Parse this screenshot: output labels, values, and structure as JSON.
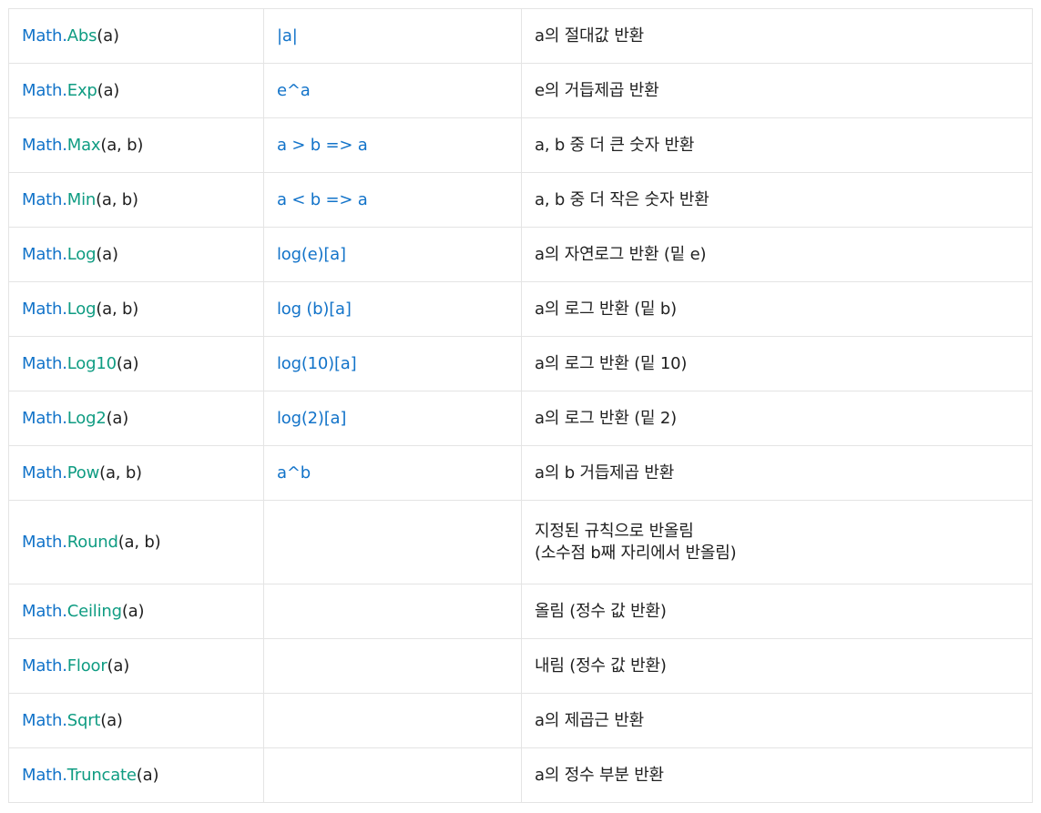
{
  "rows": [
    {
      "cls": "Math",
      "dot": ".",
      "method": "Abs",
      "args": "(a)",
      "formula": "|a|",
      "desc": [
        "a의 절대값 반환"
      ]
    },
    {
      "cls": "Math",
      "dot": ".",
      "method": "Exp",
      "args": "(a)",
      "formula": "e^a",
      "desc": [
        "e의 거듭제곱 반환"
      ]
    },
    {
      "cls": "Math",
      "dot": ".",
      "method": "Max",
      "args": "(a, b)",
      "formula": "a > b => a",
      "desc": [
        "a, b 중 더 큰 숫자 반환"
      ]
    },
    {
      "cls": "Math",
      "dot": ".",
      "method": "Min",
      "args": "(a, b)",
      "formula": "a < b => a",
      "desc": [
        "a, b 중 더 작은 숫자 반환"
      ]
    },
    {
      "cls": "Math",
      "dot": ".",
      "method": "Log",
      "args": "(a)",
      "formula": "log(e)[a]",
      "desc": [
        "a의 자연로그 반환 (밑 e)"
      ]
    },
    {
      "cls": "Math",
      "dot": ".",
      "method": "Log",
      "args": "(a, b)",
      "formula": "log (b)[a]",
      "desc": [
        "a의 로그 반환 (밑 b)"
      ]
    },
    {
      "cls": "Math",
      "dot": ".",
      "method": "Log10",
      "args": "(a)",
      "formula": "log(10)[a]",
      "desc": [
        "a의 로그 반환 (밑 10)"
      ]
    },
    {
      "cls": "Math",
      "dot": ".",
      "method": "Log2",
      "args": "(a)",
      "formula": "log(2)[a]",
      "desc": [
        "a의 로그 반환 (밑 2)"
      ]
    },
    {
      "cls": "Math",
      "dot": ".",
      "method": "Pow",
      "args": "(a, b)",
      "formula": "a^b",
      "desc": [
        "a의 b 거듭제곱 반환"
      ]
    },
    {
      "cls": "Math",
      "dot": ".",
      "method": "Round",
      "args": "(a, b)",
      "formula": "",
      "desc": [
        "지정된 규칙으로 반올림",
        "(소수점 b째 자리에서 반올림)"
      ]
    },
    {
      "cls": "Math",
      "dot": ".",
      "method": "Ceiling",
      "args": "(a)",
      "formula": "",
      "desc": [
        "올림 (정수 값 반환)"
      ]
    },
    {
      "cls": "Math",
      "dot": ".",
      "method": "Floor",
      "args": "(a)",
      "formula": "",
      "desc": [
        "내림 (정수 값 반환)"
      ]
    },
    {
      "cls": "Math",
      "dot": ".",
      "method": "Sqrt",
      "args": "(a)",
      "formula": "",
      "desc": [
        "a의 제곱근 반환"
      ]
    },
    {
      "cls": "Math",
      "dot": ".",
      "method": "Truncate",
      "args": "(a)",
      "formula": "",
      "desc": [
        "a의 정수 부분 반환"
      ]
    }
  ],
  "colors": {
    "class": "#1273c9",
    "method": "#0f9c82",
    "args": "#1f1f1f",
    "formula": "#1273c9",
    "text": "#1f1f1f",
    "border": "#e4e4e4"
  }
}
